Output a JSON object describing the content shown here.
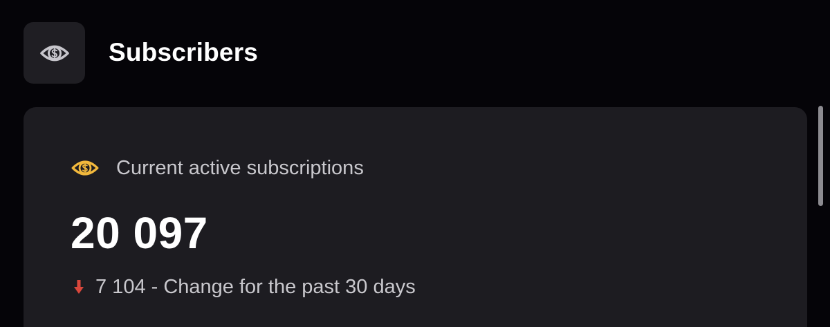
{
  "header": {
    "title": "Subscribers",
    "icon": "dollar-eye-icon"
  },
  "card": {
    "label": "Current active subscriptions",
    "label_icon": "dollar-eye-icon",
    "value": "20 097",
    "change": {
      "direction_icon": "arrow-down-icon",
      "text": "7 104 - Change for the past 30 days"
    }
  },
  "colors": {
    "background": "#050408",
    "card": "#1d1c21",
    "accent_gold": "#f2b83c",
    "decrease_red": "#d9473c",
    "muted_text": "#c9c8cd"
  }
}
